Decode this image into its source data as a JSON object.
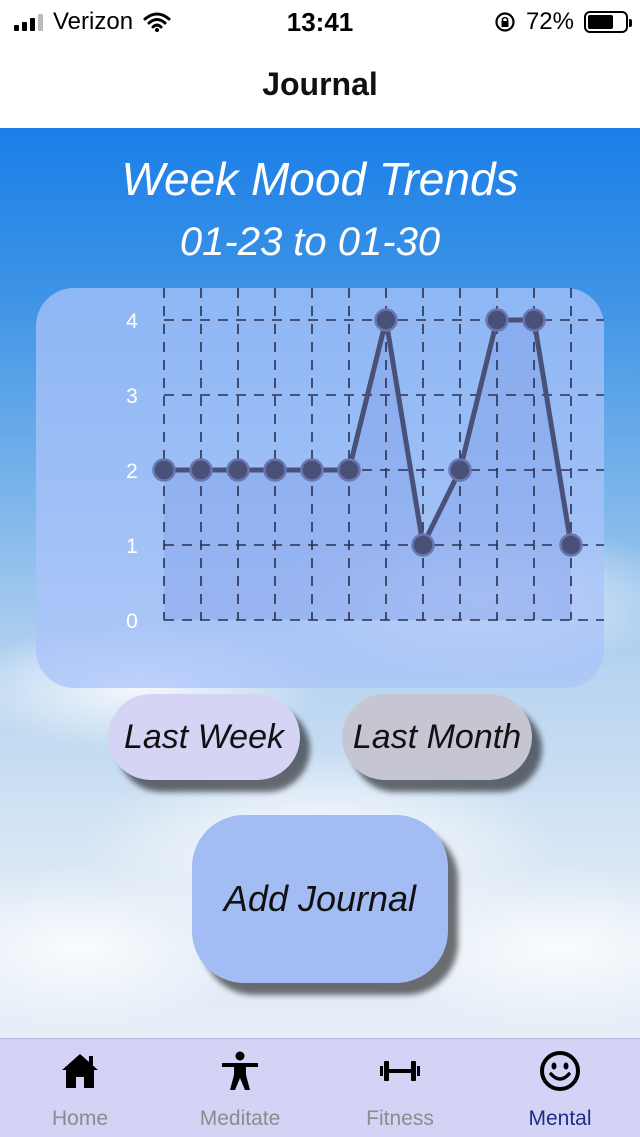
{
  "status_bar": {
    "carrier": "Verizon",
    "time": "13:41",
    "battery": "72%"
  },
  "nav": {
    "title": "Journal"
  },
  "main": {
    "heading": "Week Mood Trends",
    "date_range": "01-23 to 01-30",
    "buttons": {
      "last_week": "Last Week",
      "last_month": "Last Month",
      "add_journal": "Add Journal"
    }
  },
  "chart_data": {
    "type": "line",
    "x": [
      1,
      2,
      3,
      4,
      5,
      6,
      7,
      8,
      9,
      10,
      11,
      12
    ],
    "values": [
      2,
      2,
      2,
      2,
      2,
      2,
      4,
      1,
      2,
      4,
      4,
      1
    ],
    "yticks": [
      "0",
      "1",
      "2",
      "3",
      "4"
    ],
    "ylim": [
      0,
      4
    ],
    "grid": true,
    "fill": true,
    "colors": {
      "line": "#4a5178",
      "point": "#4a5178",
      "fill": "#7c97e4",
      "grid": "#2a3050",
      "tick_label": "#ffffff"
    }
  },
  "tabs": [
    {
      "label": "Home",
      "icon": "home-icon",
      "active": false
    },
    {
      "label": "Meditate",
      "icon": "person-icon",
      "active": false
    },
    {
      "label": "Fitness",
      "icon": "dumbbell-icon",
      "active": false
    },
    {
      "label": "Mental",
      "icon": "smiley-icon",
      "active": true
    }
  ],
  "colors": {
    "tab_active": "#1a2f88",
    "tab_inactive": "#8c8c8c",
    "tab_bar": "#d5d3f5"
  }
}
